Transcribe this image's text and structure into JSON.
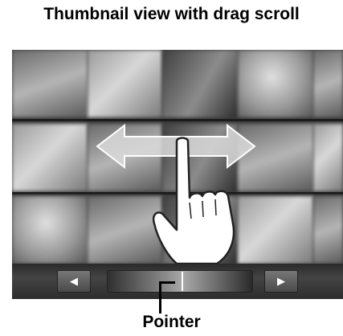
{
  "title": "Thumbnail view with drag scroll",
  "callout": {
    "label": "Pointer"
  },
  "scrollbar": {
    "left_icon": "◀",
    "right_icon": "▶"
  }
}
